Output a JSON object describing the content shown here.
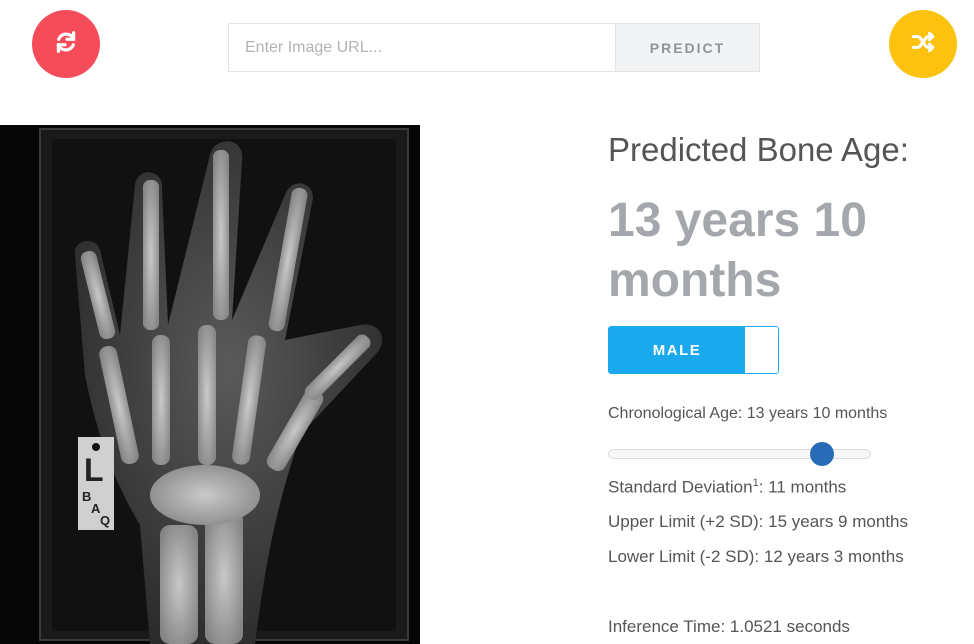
{
  "header": {
    "refresh_icon": "refresh-icon",
    "shuffle_icon": "shuffle-icon",
    "url_placeholder": "Enter Image URL...",
    "predict_label": "PREDICT"
  },
  "image": {
    "description_icon": "hand-xray",
    "marker_letter": "L",
    "marker_code_1": "B",
    "marker_code_2": "A",
    "marker_code_3": "Q"
  },
  "results": {
    "predicted_label": "Predicted Bone Age:",
    "predicted_value": "13 years 10 months",
    "sex_toggle_label": "MALE",
    "chronological_age": "Chronological Age: 13 years 10 months",
    "chronological_slider_level": 0.81,
    "sd_label": "Standard Deviation",
    "sd_superscript": "1",
    "sd_value": ": 11 months",
    "upper_limit": "Upper Limit (+2 SD): 15 years 9 months",
    "lower_limit": "Lower Limit (-2 SD): 12 years 3 months",
    "inference_time": "Inference Time: 1.0521 seconds"
  },
  "colors": {
    "refresh_button": "#f64c5a",
    "shuffle_button": "#fdc20f",
    "toggle_blue": "#19a9ec",
    "slider_thumb": "#2a6bb8"
  }
}
